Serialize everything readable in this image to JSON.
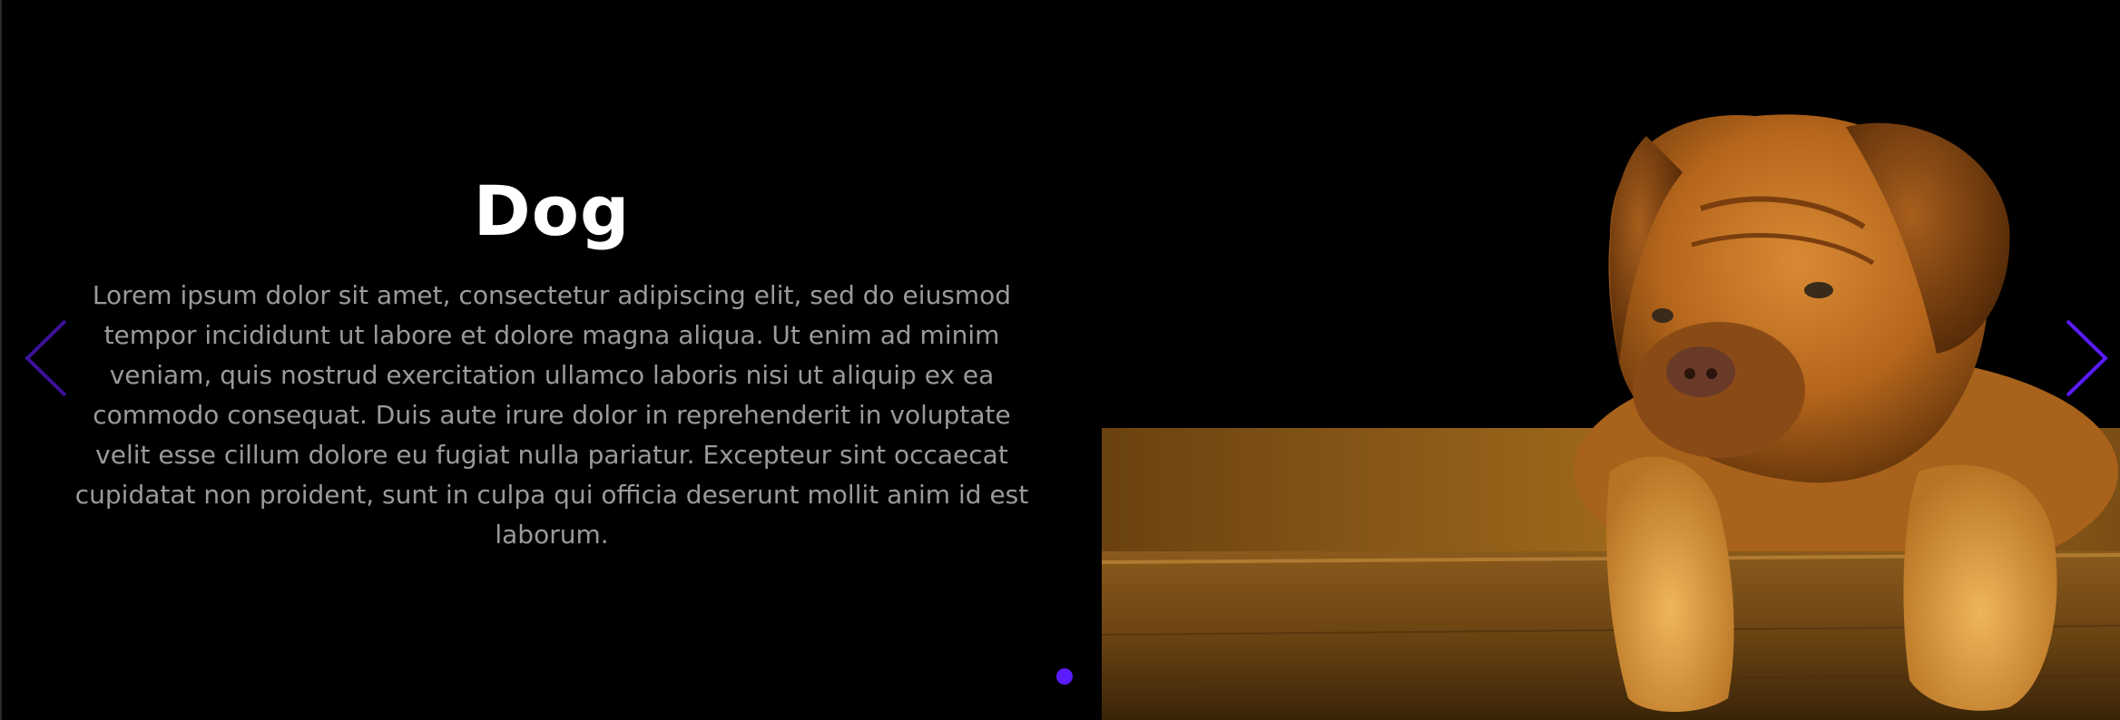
{
  "slide": {
    "title": "Dog",
    "description": "Lorem ipsum dolor sit amet, consectetur adipiscing elit, sed do eiusmod tempor incididunt ut labore et dolore magna aliqua. Ut enim ad minim veniam, quis nostrud exercitation ullamco laboris nisi ut aliquip ex ea commodo consequat. Duis aute irure dolor in reprehenderit in voluptate velit esse cillum dolore eu fugiat nulla pariatur. Excepteur sint occaecat cupidatat non proident, sunt in culpa qui officia deserunt mollit anim id est laborum.",
    "image_icon": "dog-photo"
  },
  "navigation": {
    "prev_icon": "chevron-left-icon",
    "next_icon": "chevron-right-icon",
    "accent_color": "#5b1bff",
    "prev_color": "#3a1399"
  },
  "pagination": {
    "total": 1,
    "active": 1
  }
}
